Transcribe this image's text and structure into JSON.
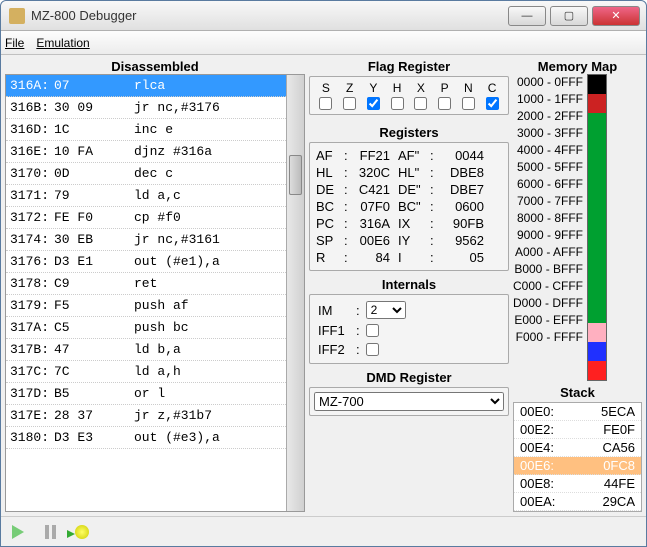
{
  "window": {
    "title": "MZ-800 Debugger"
  },
  "menu": {
    "file": "File",
    "emulation": "Emulation"
  },
  "headings": {
    "dis": "Disassembled",
    "flags": "Flag Register",
    "regs": "Registers",
    "internals": "Internals",
    "dmd": "DMD Register",
    "mem": "Memory Map",
    "stack": "Stack"
  },
  "disasm": [
    {
      "addr": "316A:",
      "bytes": "07",
      "mn": "rlca",
      "sel": true
    },
    {
      "addr": "316B:",
      "bytes": "30 09",
      "mn": "jr nc,#3176"
    },
    {
      "addr": "316D:",
      "bytes": "1C",
      "mn": "inc e"
    },
    {
      "addr": "316E:",
      "bytes": "10 FA",
      "mn": "djnz #316a"
    },
    {
      "addr": "3170:",
      "bytes": "0D",
      "mn": "dec c"
    },
    {
      "addr": "3171:",
      "bytes": "79",
      "mn": "ld a,c"
    },
    {
      "addr": "3172:",
      "bytes": "FE F0",
      "mn": "cp #f0"
    },
    {
      "addr": "3174:",
      "bytes": "30 EB",
      "mn": "jr nc,#3161"
    },
    {
      "addr": "3176:",
      "bytes": "D3 E1",
      "mn": "out (#e1),a"
    },
    {
      "addr": "3178:",
      "bytes": "C9",
      "mn": "ret"
    },
    {
      "addr": "3179:",
      "bytes": "F5",
      "mn": "push af"
    },
    {
      "addr": "317A:",
      "bytes": "C5",
      "mn": "push bc"
    },
    {
      "addr": "317B:",
      "bytes": "47",
      "mn": "ld b,a"
    },
    {
      "addr": "317C:",
      "bytes": "7C",
      "mn": "ld a,h"
    },
    {
      "addr": "317D:",
      "bytes": "B5",
      "mn": "or l"
    },
    {
      "addr": "317E:",
      "bytes": "28 37",
      "mn": "jr z,#31b7"
    },
    {
      "addr": "3180:",
      "bytes": "D3 E3",
      "mn": "out (#e3),a"
    }
  ],
  "flags": {
    "labels": [
      "S",
      "Z",
      "Y",
      "H",
      "X",
      "P",
      "N",
      "C"
    ],
    "values": [
      false,
      false,
      true,
      false,
      false,
      false,
      false,
      true
    ]
  },
  "registers": [
    {
      "n": "AF",
      "v": "FF21",
      "n2": "AF\"",
      "v2": "0044"
    },
    {
      "n": "HL",
      "v": "320C",
      "n2": "HL\"",
      "v2": "DBE8"
    },
    {
      "n": "DE",
      "v": "C421",
      "n2": "DE\"",
      "v2": "DBE7"
    },
    {
      "n": "BC",
      "v": "07F0",
      "n2": "BC\"",
      "v2": "0600"
    },
    {
      "n": "PC",
      "v": "316A",
      "n2": "IX",
      "v2": "90FB"
    },
    {
      "n": "SP",
      "v": "00E6",
      "n2": "IY",
      "v2": "9562"
    },
    {
      "n": "R",
      "v": "84",
      "n2": "I",
      "v2": "05"
    }
  ],
  "internals": {
    "im_label": "IM",
    "im_value": "2",
    "iff1_label": "IFF1",
    "iff1": false,
    "iff2_label": "IFF2",
    "iff2": false
  },
  "dmd": {
    "selected": "MZ-700"
  },
  "memmap": [
    {
      "label": "0000 - 0FFF",
      "color": "#000000"
    },
    {
      "label": "1000 - 1FFF",
      "color": "#cc2222"
    },
    {
      "label": "2000 - 2FFF",
      "color": "#00a030"
    },
    {
      "label": "3000 - 3FFF",
      "color": "#00a030"
    },
    {
      "label": "4000 - 4FFF",
      "color": "#00a030"
    },
    {
      "label": "5000 - 5FFF",
      "color": "#00a030"
    },
    {
      "label": "6000 - 6FFF",
      "color": "#00a030"
    },
    {
      "label": "7000 - 7FFF",
      "color": "#00a030"
    },
    {
      "label": "8000 - 8FFF",
      "color": "#00a030"
    },
    {
      "label": "9000 - 9FFF",
      "color": "#00a030"
    },
    {
      "label": "A000 - AFFF",
      "color": "#00a030"
    },
    {
      "label": "B000 - BFFF",
      "color": "#00a030"
    },
    {
      "label": "C000 - CFFF",
      "color": "#00a030"
    },
    {
      "label": "D000 - DFFF",
      "color": "#ffb0c0"
    },
    {
      "label": "E000 - EFFF",
      "color": "#2030ff"
    },
    {
      "label": "F000 - FFFF",
      "color": "#ff2020"
    }
  ],
  "stack": [
    {
      "addr": "00E0:",
      "val": "5ECA"
    },
    {
      "addr": "00E2:",
      "val": "FE0F"
    },
    {
      "addr": "00E4:",
      "val": "CA56"
    },
    {
      "addr": "00E6:",
      "val": "0FC8",
      "sel": true
    },
    {
      "addr": "00E8:",
      "val": "44FE"
    },
    {
      "addr": "00EA:",
      "val": "29CA"
    }
  ],
  "chart_data": {
    "type": "table",
    "title": "Memory Map",
    "categories": [
      "0000-0FFF",
      "1000-1FFF",
      "2000-2FFF",
      "3000-3FFF",
      "4000-4FFF",
      "5000-5FFF",
      "6000-6FFF",
      "7000-7FFF",
      "8000-8FFF",
      "9000-9FFF",
      "A000-AFFF",
      "B000-BFFF",
      "C000-CFFF",
      "D000-DFFF",
      "E000-EFFF",
      "F000-FFFF"
    ],
    "values": [
      "black",
      "red",
      "green",
      "green",
      "green",
      "green",
      "green",
      "green",
      "green",
      "green",
      "green",
      "green",
      "green",
      "pink",
      "blue",
      "red"
    ]
  }
}
